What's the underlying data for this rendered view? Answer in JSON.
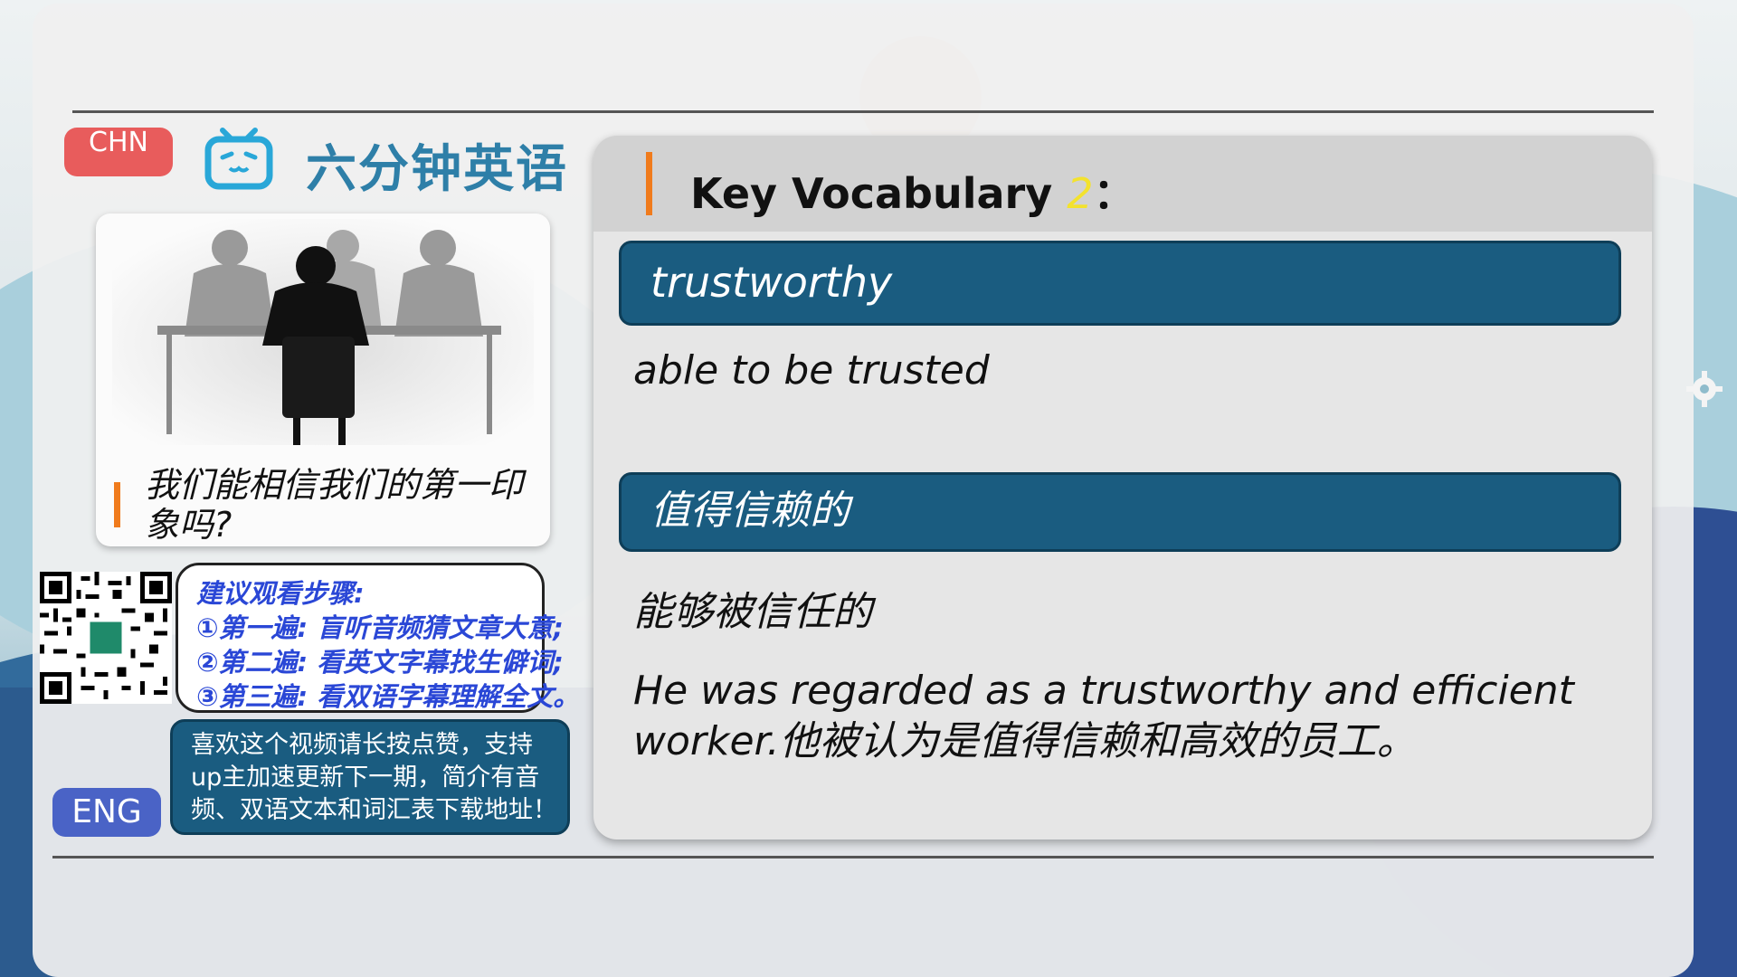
{
  "header": {
    "chn_button": "CHN",
    "brand_title": "六分钟英语",
    "logo_icon": "bilibili-tv-icon"
  },
  "sidebar": {
    "episode_caption": "我们能相信我们的第一印象吗?",
    "steps": {
      "title": "建议观看步骤:",
      "step1": "①第一遍: 盲听音频猜文章大意;",
      "step2": "②第二遍: 看英文字幕找生僻词;",
      "step3": "③第三遍: 看双语字幕理解全文。"
    },
    "promo": {
      "line1": "喜欢这个视频请长按点赞，支持",
      "line2": "up主加速更新下一期，简介有音",
      "line3": "频、双语文本和词汇表下载地址！"
    },
    "eng_button": "ENG"
  },
  "vocab": {
    "heading": "Key Vocabulary",
    "number": "2",
    "colon": "：",
    "word": "trustworthy",
    "definition": "able to be trusted",
    "translation": "值得信赖的",
    "translation_definition": "能够被信任的",
    "example": "He was regarded as a trustworthy and efficient worker.他被认为是值得信赖和高效的员工。"
  },
  "colors": {
    "accent_orange": "#f07b1c",
    "banner_blue": "#1a5c80",
    "chn_red": "#e85c5c",
    "eng_blue": "#4a63c6",
    "steps_text": "#2a47d6",
    "brand_teal": "#2e7fa8"
  }
}
